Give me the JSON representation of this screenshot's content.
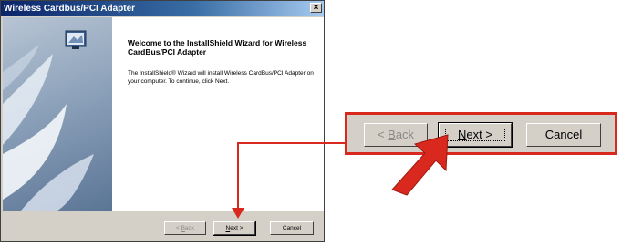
{
  "window": {
    "title": "Wireless Cardbus/PCI Adapter",
    "close_label": "×"
  },
  "welcome": {
    "title": "Welcome to the InstallShield Wizard for Wireless CardBus/PCI Adapter",
    "body": "The InstallShield® Wizard will install Wireless CardBus/PCI Adapter on your computer.  To continue, click Next."
  },
  "buttons": {
    "back": {
      "prefix": "< ",
      "key": "B",
      "rest": "ack"
    },
    "next": {
      "key": "N",
      "rest": "ext >"
    },
    "cancel": "Cancel"
  },
  "colors": {
    "callout_border": "#d9281e",
    "dialog_face": "#d4d0c8",
    "title_bar": "#0a246a"
  },
  "icons": [
    "installshield-monitor-icon",
    "close-icon",
    "annotation-arrow-icon"
  ]
}
